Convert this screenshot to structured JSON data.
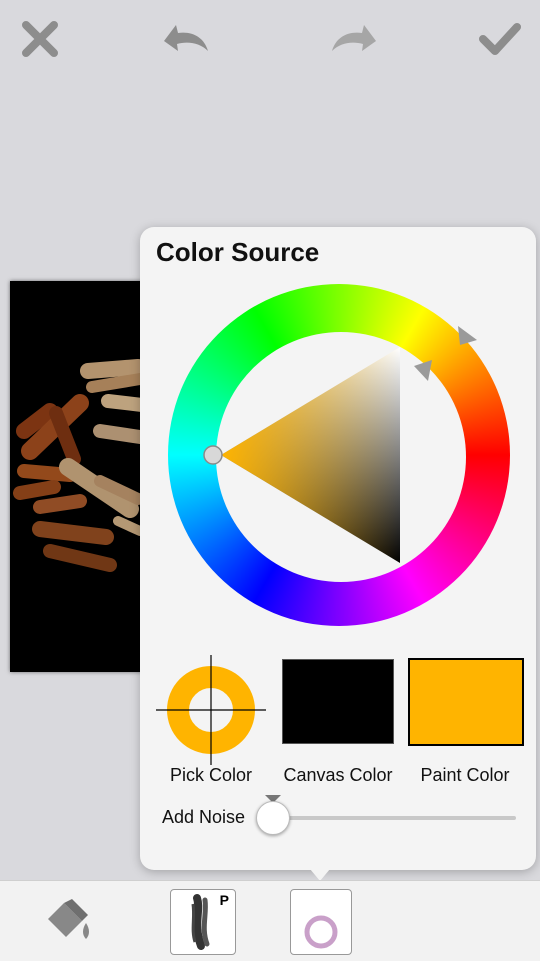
{
  "toolbar": {
    "close_icon": "close-icon",
    "undo_icon": "undo-icon",
    "redo_icon": "redo-icon",
    "confirm_icon": "checkmark-icon"
  },
  "color_source": {
    "title": "Color Source",
    "pick_color_label": "Pick Color",
    "canvas_color_label": "Canvas Color",
    "paint_color_label": "Paint Color",
    "canvas_color": "#000000",
    "paint_color": "#ffb400",
    "add_noise_label": "Add Noise",
    "add_noise_value": 0
  },
  "bottom_toolbar": {
    "fill_icon": "paint-bucket-icon",
    "brush_badge": "P"
  }
}
